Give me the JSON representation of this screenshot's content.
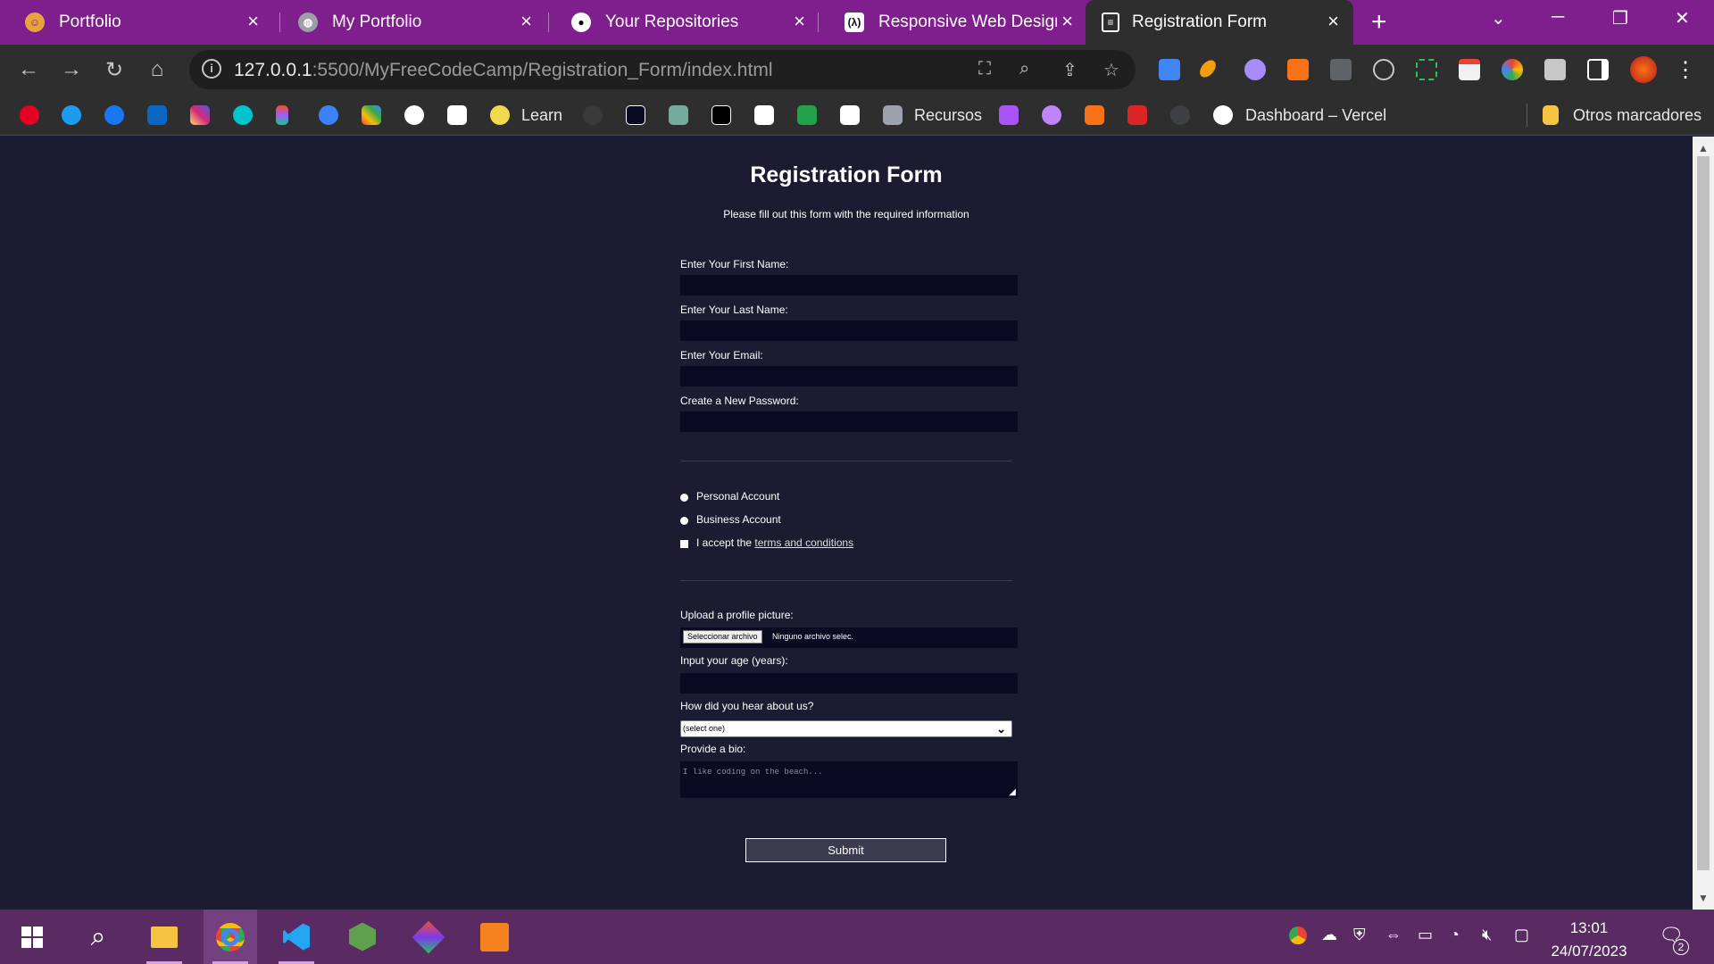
{
  "tabs": [
    {
      "title": "Portfolio",
      "icon": "portfolio-favicon",
      "color": "#e8a33d"
    },
    {
      "title": "My Portfolio",
      "icon": "globe-favicon",
      "color": "#9aa0a6"
    },
    {
      "title": "Your Repositories",
      "icon": "github-favicon",
      "color": "#ffffff"
    },
    {
      "title": "Responsive Web Design C",
      "icon": "freecodecamp-favicon",
      "color": "#0a0a23"
    },
    {
      "title": "Registration Form",
      "icon": "document-favicon",
      "color": "#ffffff"
    }
  ],
  "toolbar": {
    "url_host": "127.0.0.1",
    "url_path": ":5500/MyFreeCodeCamp/Registration_Form/index.html"
  },
  "bookmarks": {
    "items": [
      {
        "icon": "pinterest-icon",
        "color": "#e60023"
      },
      {
        "icon": "twitter-icon",
        "color": "#1d9bf0"
      },
      {
        "icon": "facebook-icon",
        "color": "#1877f2"
      },
      {
        "icon": "linkedin-icon",
        "color": "#0a66c2"
      },
      {
        "icon": "instagram-icon",
        "color": "#d62976"
      },
      {
        "icon": "canva-icon",
        "color": "#00c4cc"
      },
      {
        "icon": "figma-icon",
        "color": "#f24e1e"
      },
      {
        "icon": "bookmark-app-icon",
        "color": "#3b82f6"
      },
      {
        "icon": "colorful-app-icon",
        "color": "#ea4335"
      },
      {
        "icon": "refresh-app-icon",
        "color": "#ffffff"
      },
      {
        "icon": "unsplash-icon",
        "color": "#ffffff"
      }
    ],
    "learn_label": "Learn",
    "more_items": [
      {
        "icon": "github-bookmark-icon",
        "color": "#3a3a3a"
      },
      {
        "icon": "freecodecamp-bookmark-icon",
        "color": "#0a0a23"
      },
      {
        "icon": "chatgpt-icon",
        "color": "#74aa9c"
      },
      {
        "icon": "m-app-icon",
        "color": "#000000"
      },
      {
        "icon": "codepen-icon",
        "color": "#ffffff"
      },
      {
        "icon": "w-app-icon",
        "color": "#22a24a"
      },
      {
        "icon": "w3schools-icon",
        "color": "#ffffff"
      }
    ],
    "recursos_label": "Recursos",
    "tail_items": [
      {
        "icon": "character-app-icon",
        "color": "#a855f7"
      },
      {
        "icon": "pink-app-icon",
        "color": "#c084fc"
      },
      {
        "icon": "orange-app-icon",
        "color": "#f97316"
      },
      {
        "icon": "red-m-icon",
        "color": "#dc2626"
      },
      {
        "icon": "dark-app-icon",
        "color": "#3f3f46"
      }
    ],
    "vercel_label": "Dashboard – Vercel",
    "other_label": "Otros marcadores"
  },
  "form": {
    "title": "Registration Form",
    "description": "Please fill out this form with the required information",
    "first_name_label": "Enter Your First Name:",
    "last_name_label": "Enter Your Last Name:",
    "email_label": "Enter Your Email:",
    "password_label": "Create a New Password:",
    "personal_label": "Personal Account",
    "business_label": "Business Account",
    "terms_prefix": "I accept the ",
    "terms_link": "terms and conditions",
    "upload_label": "Upload a profile picture:",
    "file_button": "Seleccionar archivo",
    "file_status": "Ninguno archivo selec.",
    "age_label": "Input your age (years):",
    "referrer_label": "How did you hear about us?",
    "referrer_value": "(select one)",
    "bio_label": "Provide a bio:",
    "bio_placeholder": "I like coding on the beach...",
    "submit_label": "Submit"
  },
  "taskbar": {
    "time": "13:01",
    "date": "24/07/2023",
    "notifications": "2",
    "apps": [
      {
        "icon": "windows-start-icon",
        "color": "#ffffff"
      },
      {
        "icon": "search-icon",
        "color": "#ffffff"
      },
      {
        "icon": "file-explorer-icon",
        "color": "#f5c542"
      },
      {
        "icon": "chrome-icon",
        "color": "#4285f4"
      },
      {
        "icon": "vscode-icon",
        "color": "#22a6f2"
      },
      {
        "icon": "nodejs-icon",
        "color": "#5fa04e"
      },
      {
        "icon": "git-app-icon",
        "color": "#f05032"
      },
      {
        "icon": "pdf-app-icon",
        "color": "#f5821f"
      }
    ]
  }
}
